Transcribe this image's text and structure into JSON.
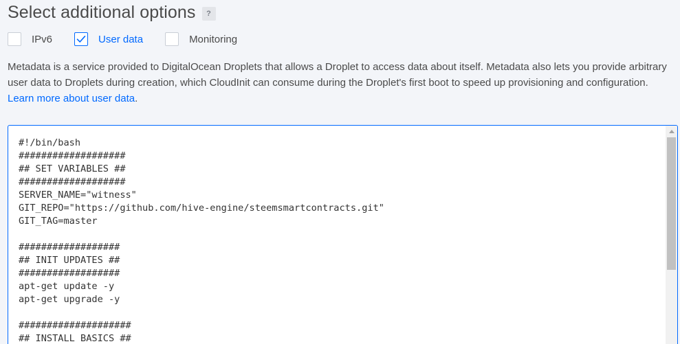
{
  "section": {
    "title": "Select additional options",
    "help_badge": "?"
  },
  "options": [
    {
      "label": "IPv6",
      "checked": false
    },
    {
      "label": "User data",
      "checked": true
    },
    {
      "label": "Monitoring",
      "checked": false
    }
  ],
  "description": {
    "text": "Metadata is a service provided to DigitalOcean Droplets that allows a Droplet to access data about itself. Metadata also lets you provide arbitrary user data to Droplets during creation, which CloudInit can consume during the Droplet's first boot to speed up provisioning and configuration. ",
    "link_text": "Learn more about user data",
    "trailing": "."
  },
  "user_data": {
    "code": "#!/bin/bash\n###################\n## SET VARIABLES ##\n###################\nSERVER_NAME=\"witness\"\nGIT_REPO=\"https://github.com/hive-engine/steemsmartcontracts.git\"\nGIT_TAG=master\n\n##################\n## INIT UPDATES ##\n##################\napt-get update -y\napt-get upgrade -y\n\n####################\n## INSTALL BASICS ##"
  },
  "colors": {
    "accent": "#0069ff",
    "text": "#4a4a4a",
    "background": "#f3f5f9"
  },
  "icons": {
    "checkbox_check": "check-icon",
    "scroll_up": "scroll-up-arrow-icon"
  }
}
